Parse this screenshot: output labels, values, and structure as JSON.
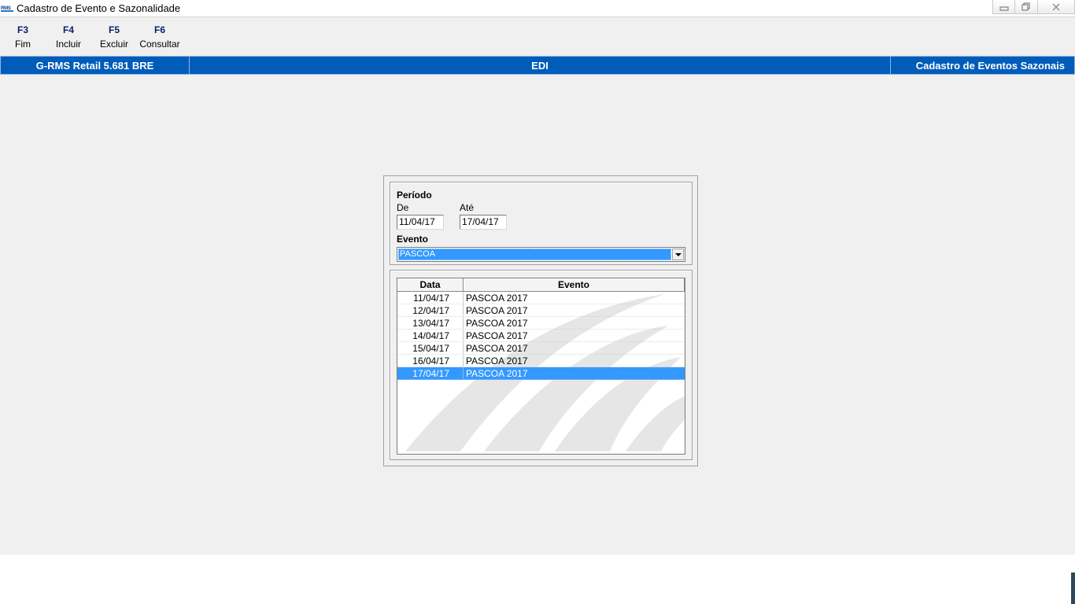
{
  "window": {
    "title": "Cadastro de Evento e Sazonalidade",
    "icon_text": "RMS"
  },
  "function_keys": [
    {
      "key": "F3",
      "label": "Fim"
    },
    {
      "key": "F4",
      "label": "Incluir"
    },
    {
      "key": "F5",
      "label": "Excluir"
    },
    {
      "key": "F6",
      "label": "Consultar"
    }
  ],
  "status_bar": {
    "app": "G-RMS Retail 5.681 BRE",
    "module": "EDI",
    "screen": "Cadastro de Eventos Sazonais"
  },
  "form": {
    "periodo_label": "Período",
    "de_label": "De",
    "ate_label": "Até",
    "de_value": "11/04/17",
    "ate_value": "17/04/17",
    "evento_label": "Evento",
    "evento_value": "PASCOA"
  },
  "grid": {
    "headers": [
      "Data",
      "Evento"
    ],
    "rows": [
      {
        "data": "11/04/17",
        "evento": "PASCOA 2017"
      },
      {
        "data": "12/04/17",
        "evento": "PASCOA 2017"
      },
      {
        "data": "13/04/17",
        "evento": "PASCOA 2017"
      },
      {
        "data": "14/04/17",
        "evento": "PASCOA 2017"
      },
      {
        "data": "15/04/17",
        "evento": "PASCOA 2017"
      },
      {
        "data": "16/04/17",
        "evento": "PASCOA 2017"
      },
      {
        "data": "17/04/17",
        "evento": "PASCOA 2017"
      }
    ],
    "selected_index": 6
  },
  "colors": {
    "status_bar": "#005cb9",
    "selection": "#3399ff",
    "fkey_text": "#0a1f6b"
  }
}
